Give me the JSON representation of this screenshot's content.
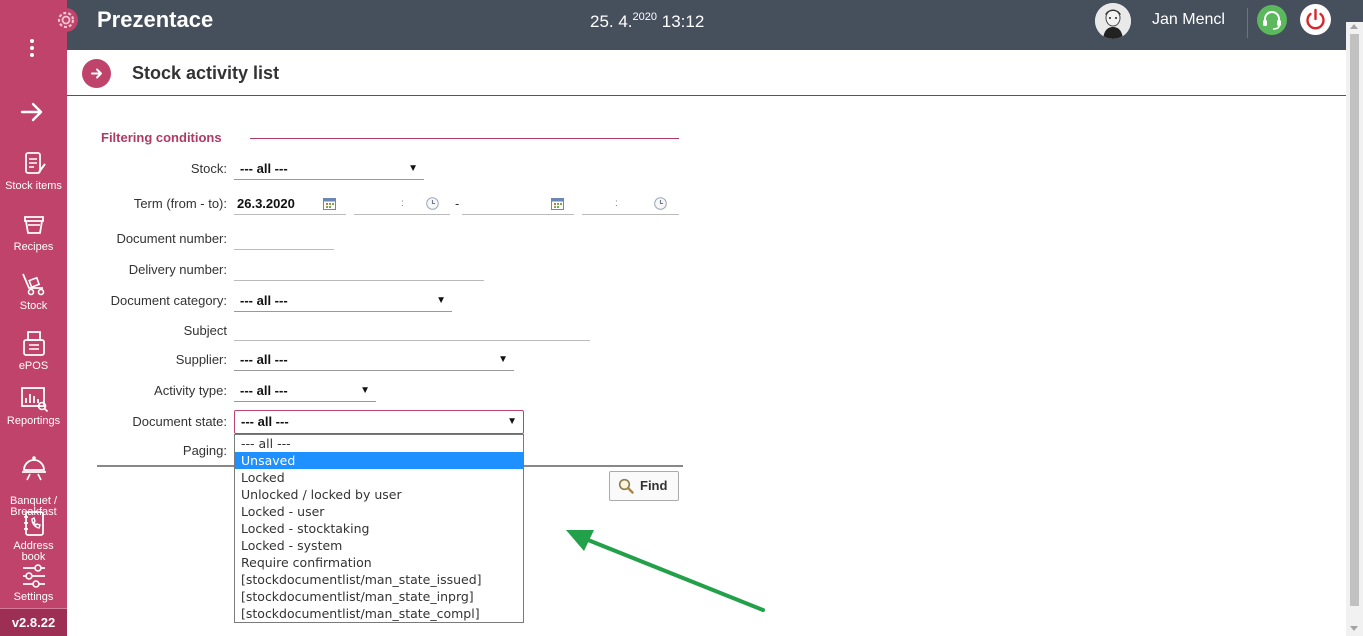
{
  "sidebar": {
    "version": "v2.8.22",
    "items": [
      {
        "label": "Stock items",
        "icon": "stock-items-icon"
      },
      {
        "label": "Recipes",
        "icon": "recipes-icon"
      },
      {
        "label": "Stock",
        "icon": "stock-icon"
      },
      {
        "label": "ePOS",
        "icon": "epos-icon"
      },
      {
        "label": "Reportings",
        "icon": "reportings-icon"
      },
      {
        "label": "Banquet /\nBreakfast",
        "icon": "banquet-icon"
      },
      {
        "label": "Address book",
        "icon": "address-book-icon"
      },
      {
        "label": "Settings",
        "icon": "settings-icon"
      }
    ]
  },
  "header": {
    "app_title": "Prezentace",
    "date": "25. 4.",
    "year": "2020",
    "time": "13:12",
    "user_name": "Jan Mencl"
  },
  "page": {
    "title": "Stock activity list"
  },
  "filter": {
    "section_title": "Filtering conditions",
    "stock": {
      "label": "Stock:",
      "value": "--- all ---"
    },
    "term": {
      "label": "Term (from - to):",
      "from_date": "26.3.2020",
      "time_sep": ":",
      "range_sep": "-"
    },
    "document_number": {
      "label": "Document number:",
      "value": ""
    },
    "delivery_number": {
      "label": "Delivery number:",
      "value": ""
    },
    "document_category": {
      "label": "Document category:",
      "value": "--- all ---"
    },
    "subject": {
      "label": "Subject",
      "value": ""
    },
    "supplier": {
      "label": "Supplier:",
      "value": "--- all ---"
    },
    "activity_type": {
      "label": "Activity type:",
      "value": "--- all ---"
    },
    "document_state": {
      "label": "Document state:",
      "value": "--- all ---",
      "options": [
        "--- all ---",
        "Unsaved",
        "Locked",
        "Unlocked / locked by user",
        "Locked - user",
        "Locked - stocktaking",
        "Locked - system",
        "Require confirmation",
        "[stockdocumentlist/man_state_issued]",
        "[stockdocumentlist/man_state_inprg]",
        "[stockdocumentlist/man_state_compl]"
      ],
      "highlighted_option": "Unsaved"
    },
    "paging": {
      "label": "Paging:"
    },
    "find_button": "Find"
  },
  "colors": {
    "brand": "#c0436b",
    "header_bg": "#464f5c",
    "highlight": "#1e90ff",
    "annotation_arrow": "#22a04a"
  }
}
